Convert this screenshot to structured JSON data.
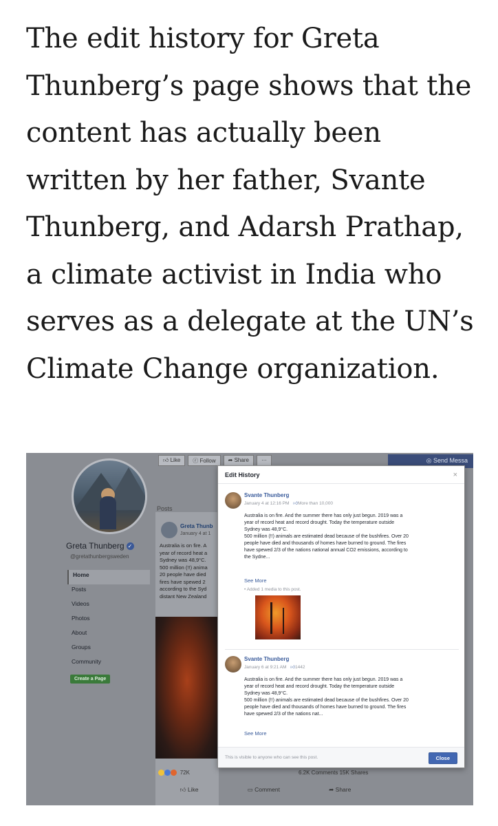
{
  "headline": "The edit history for Greta Thunberg’s page shows that the content has actually been written by her father, Svante Thunberg, and Adarsh Prathap, a climate activist in India who serves as a delegate at the UN’s Climate Change organization.",
  "fb_page": {
    "toolbar": {
      "like": "Like",
      "follow": "Follow",
      "share": "Share",
      "more": "···"
    },
    "send_message": "Send Messa",
    "page_name": "Greta Thunberg",
    "handle": "@gretathunbergsweden",
    "nav": [
      "Home",
      "Posts",
      "Videos",
      "Photos",
      "About",
      "Groups",
      "Community"
    ],
    "create_page": "Create a Page",
    "posts_label": "Posts",
    "post": {
      "name": "Greta Thunb",
      "date": "January 4 at 1",
      "text": "Australia is on fire. A\nyear of record heat a\nSydney was 48,9°C.\n500 million (!!) anima\n20 people have died\nfires have spewed 2\naccording to the Syd\ndistant New Zealand"
    },
    "reaction_count": "72K",
    "stats": "6.2K Comments  15K Shares",
    "actions": {
      "like": "Like",
      "comment": "Comment",
      "share": "Share"
    }
  },
  "modal": {
    "title": "Edit History",
    "close_x": "×",
    "entries": [
      {
        "name": "Svante Thunberg",
        "date": "January 4 at 12:16 PM",
        "audience": "More than 10,000",
        "text": "Australia is on fire. And the summer there has only just begun. 2019 was a\nyear of record heat and record drought. Today the temperature outside\nSydney was 48,9°C.\n500 million (!!) animals are estimated dead because of the bushfires. Over 20\npeople have died and thousands of homes have burned to ground. The fires\nhave spewed 2/3 of the nations national annual CO2 emissions, according to\nthe Sydne...",
        "see_more": "See More",
        "added": "•  Added 1 media to this post."
      },
      {
        "name": "Svante Thunberg",
        "date": "January 6 at 9:21 AM",
        "audience": "1442",
        "text": "Australia is on fire. And the summer there has only just begun. 2019 was a\nyear of record heat and record drought. Today the temperature outside\nSydney was 48,9°C.\n500 million (!!) animals are estimated dead because of the bushfires. Over 20\npeople have died and thousands of homes have burned to ground. The fires\nhave spewed 2/3 of the nations nat...",
        "see_more": "See More"
      }
    ],
    "footer_note": "This is visible to anyone who can see this post.",
    "close_button": "Close"
  }
}
